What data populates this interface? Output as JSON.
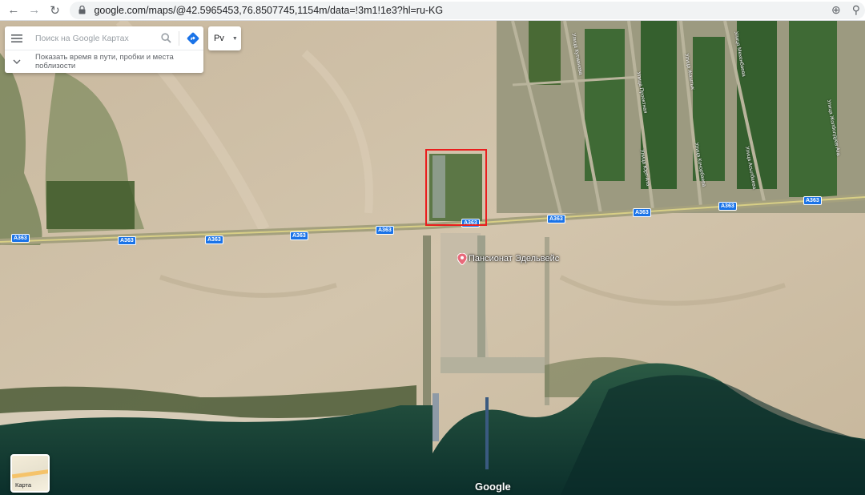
{
  "browser": {
    "url": "google.com/maps/@42.5965453,76.8507745,1154m/data=!3m1!1e3?hl=ru-KG"
  },
  "search": {
    "placeholder": "Поиск на Google Картах",
    "hint": "Показать время в пути, пробки и места поблизости"
  },
  "language_button": {
    "label": "Рv"
  },
  "road_labels": [
    {
      "text": "A363"
    },
    {
      "text": "A363"
    },
    {
      "text": "A363"
    },
    {
      "text": "A363"
    },
    {
      "text": "A363"
    },
    {
      "text": "A363"
    },
    {
      "text": "A363"
    },
    {
      "text": "A363"
    },
    {
      "text": "A363"
    },
    {
      "text": "A363"
    }
  ],
  "street_labels": [
    {
      "text": "Улица Кутманова"
    },
    {
      "text": "Улица Проектная"
    },
    {
      "text": "Улица Юрт-Ата"
    },
    {
      "text": "Улица Жаштык"
    },
    {
      "text": "Улица Кочорбаева"
    },
    {
      "text": "Улица Мекенбаева"
    },
    {
      "text": "Улица Асылбаева"
    },
    {
      "text": "Улица Жолболдуев Ата"
    }
  ],
  "place": {
    "name": "Пансионат Эдельвейс"
  },
  "layer_switch": {
    "label": "Карта"
  },
  "branding": {
    "logo_text": "Google"
  },
  "colors": {
    "highlight": "#ea1d1d",
    "road_label_bg": "#1a73e8",
    "water": "#0e3d35",
    "sand": "#cdbfa7"
  }
}
